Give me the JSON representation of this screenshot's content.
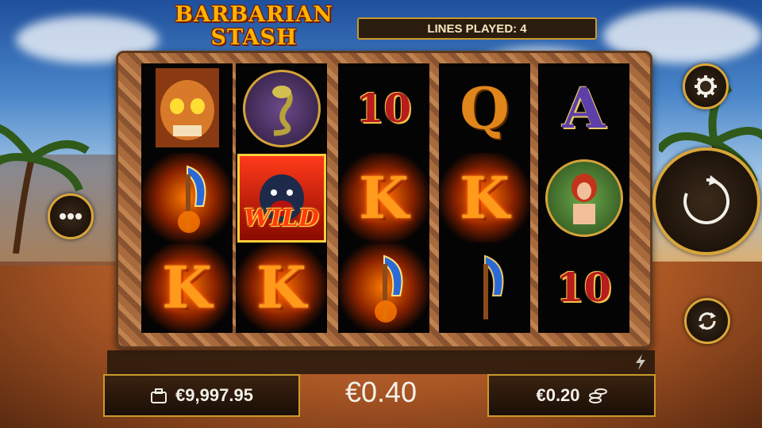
{
  "game": {
    "title_line1": "BARBARIAN",
    "title_line2": "STASH",
    "lines_played": "LINES PLAYED: 4"
  },
  "reels": [
    [
      "skull-mask",
      "axe",
      "K"
    ],
    [
      "cobra",
      "wild-gorilla",
      "K"
    ],
    [
      "10",
      "K",
      "axe"
    ],
    [
      "Q",
      "K",
      "axe"
    ],
    [
      "A",
      "warrior-woman",
      "10"
    ]
  ],
  "symbols": {
    "wild_label": "WILD",
    "K": "K",
    "ten": "10",
    "Q": "Q",
    "A": "A"
  },
  "footer": {
    "balance": "€9,997.95",
    "total_bet": "€0.40",
    "coin_value": "€0.20"
  },
  "icons": {
    "settings": "gear-icon",
    "menu": "more-dots-icon",
    "spin": "spin-arrow-icon",
    "autoplay": "autoplay-icon",
    "wallet": "wallet-icon",
    "coins": "coin-stack-icon",
    "turbo": "lightning-icon"
  },
  "colors": {
    "accent_gold": "#d9a63a",
    "title_orange": "#ffb300"
  }
}
